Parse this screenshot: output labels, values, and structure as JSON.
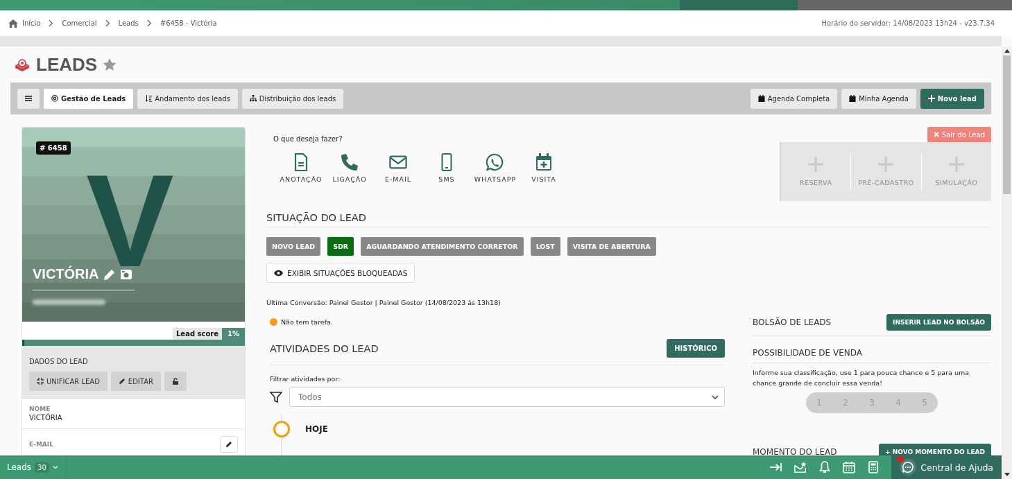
{
  "breadcrumb": {
    "items": [
      {
        "label": "Início"
      },
      {
        "label": "Comercial"
      },
      {
        "label": "Leads"
      },
      {
        "label": "#6458 - Victória"
      }
    ],
    "server_time": "Horário do servidor: 14/08/2023 13h24 - v23.7.34"
  },
  "page_title": "LEADS",
  "toolbar": {
    "tabs": [
      {
        "label": "Gestão de Leads",
        "selected": true
      },
      {
        "label": "Andamento dos leads",
        "selected": false
      },
      {
        "label": "Distribuição dos leads",
        "selected": false
      }
    ],
    "buttons": [
      {
        "label": "Agenda Completa",
        "kind": "calendar"
      },
      {
        "label": "Minha Agenda",
        "kind": "calendar"
      },
      {
        "label": "Novo lead",
        "kind": "primary"
      }
    ]
  },
  "lead_card": {
    "id": "# 6458",
    "avatar_letter": "V",
    "name": "VICTÓRIA",
    "lead_score": {
      "label": "Lead score",
      "reading": "1%",
      "level": 0.01
    },
    "section_title": "DADOS DO LEAD",
    "buttons": [
      {
        "label": "UNIFICAR LEAD",
        "kind": "merge"
      },
      {
        "label": "EDITAR",
        "kind": "edit"
      },
      {
        "kind": "lock"
      }
    ],
    "fields": [
      {
        "label": "NOME",
        "value": "VICTÓRIA"
      },
      {
        "label": "E-MAIL"
      }
    ]
  },
  "actions": {
    "prompt": "O que deseja fazer?",
    "items": [
      {
        "label": "ANOTAÇÃO"
      },
      {
        "label": "LIGAÇÃO"
      },
      {
        "label": "E-MAIL"
      },
      {
        "label": "SMS"
      },
      {
        "label": "WHATSAPP"
      },
      {
        "label": "VISITA"
      }
    ]
  },
  "extra_actions": {
    "exit_button": "Sair do Lead",
    "items": [
      {
        "label": "RESERVA",
        "disabled": true
      },
      {
        "label": "PRÉ-CADASTRO",
        "disabled": true
      },
      {
        "label": "SIMULAÇÃO",
        "disabled": true
      }
    ]
  },
  "status": {
    "title": "SITUAÇÃO DO LEAD",
    "items": [
      {
        "label": "NOVO LEAD",
        "selected": false
      },
      {
        "label": "SDR",
        "selected": true
      },
      {
        "label": "AGUARDANDO ATENDIMENTO CORRETOR",
        "selected": false
      },
      {
        "label": "LOST",
        "selected": false
      },
      {
        "label": "VISITA DE ABERTURA",
        "selected": false
      }
    ],
    "blocked_button": "EXIBIR SITUAÇÕES BLOQUEADAS"
  },
  "last_conversion": "Última Conversão: Painel Gestor | Painel Gestor (14/08/2023 às 13h18)",
  "task": {
    "text": "Não tem tarefa.",
    "color": "#f39c12"
  },
  "activities": {
    "title": "ATIVIDADES DO LEAD",
    "history_button": "HISTÓRICO",
    "filter_label": "Filtrar atividades por:",
    "filter_value": "Todos",
    "timeline": [
      {
        "label": "HOJE"
      }
    ]
  },
  "pocket": {
    "title": "BOLSÃO DE LEADS",
    "button": "INSERIR LEAD NO BOLSÃO"
  },
  "sale_possibility": {
    "title": "POSSIBILIDADE DE VENDA",
    "hint": "Informe sua classificação, use 1 para pouca chance e 5 para uma chance grande de concluir essa venda!",
    "options": [
      {
        "label": "1",
        "selected": false
      },
      {
        "label": "2",
        "selected": false
      },
      {
        "label": "3",
        "selected": false
      },
      {
        "label": "4",
        "selected": false
      },
      {
        "label": "5",
        "selected": false
      }
    ]
  },
  "moment": {
    "title": "MOMENTO DO LEAD",
    "button": "+ NOVO MOMENTO DO LEAD"
  },
  "bottom_bar": {
    "module": "Leads",
    "count": "30",
    "help": "Central de Ajuda",
    "notification": true
  }
}
